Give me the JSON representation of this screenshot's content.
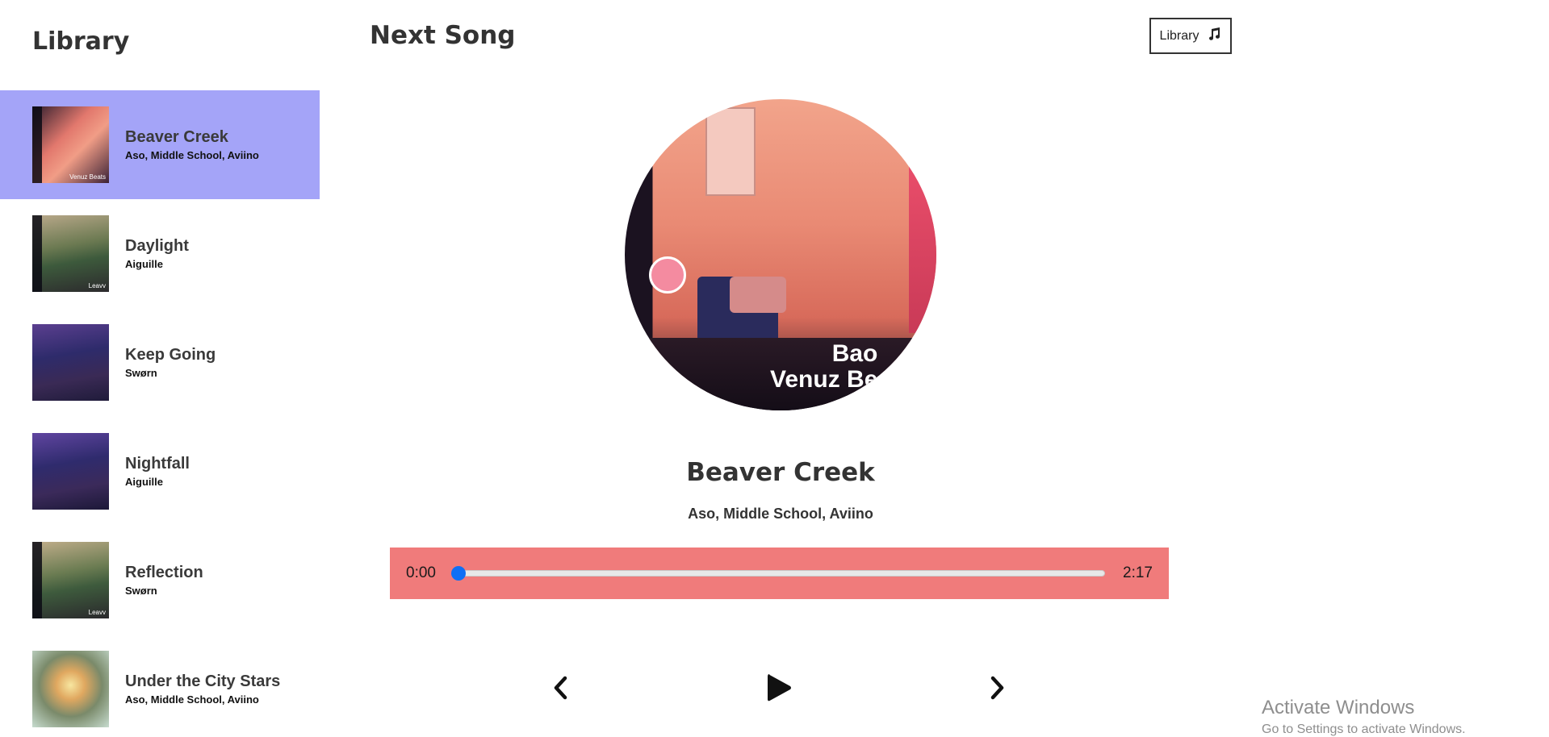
{
  "sidebar": {
    "title": "Library",
    "songs": [
      {
        "title": "Beaver Creek",
        "artist": "Aso, Middle School, Aviino",
        "cover_tag": "Venuz Beats",
        "selected": true
      },
      {
        "title": "Daylight",
        "artist": "Aiguille",
        "cover_tag": "Leavv",
        "selected": false
      },
      {
        "title": "Keep Going",
        "artist": "Swørn",
        "cover_tag": "",
        "selected": false
      },
      {
        "title": "Nightfall",
        "artist": "Aiguille",
        "cover_tag": "",
        "selected": false
      },
      {
        "title": "Reflection",
        "artist": "Swørn",
        "cover_tag": "Leavv",
        "selected": false
      },
      {
        "title": "Under the City Stars",
        "artist": "Aso, Middle School, Aviino",
        "cover_tag": "",
        "selected": false
      }
    ]
  },
  "header": {
    "title": "Next Song",
    "library_button_label": "Library",
    "library_button_icon": "music-note-icon"
  },
  "now_playing": {
    "title": "Beaver Creek",
    "artist": "Aso, Middle School, Aviino",
    "art_text_line1": "Bao",
    "art_text_line2": "Venuz Be",
    "current_time": "0:00",
    "duration": "2:17",
    "progress_fraction": 0
  },
  "controls": {
    "prev_icon": "chevron-left-icon",
    "play_icon": "play-icon",
    "next_icon": "chevron-right-icon"
  },
  "colors": {
    "selected_item": "#a4a4f8",
    "progress_panel": "#f07b7b",
    "slider_thumb": "#0f6ff5"
  },
  "watermark": {
    "title": "Activate Windows",
    "subtitle": "Go to Settings to activate Windows."
  }
}
